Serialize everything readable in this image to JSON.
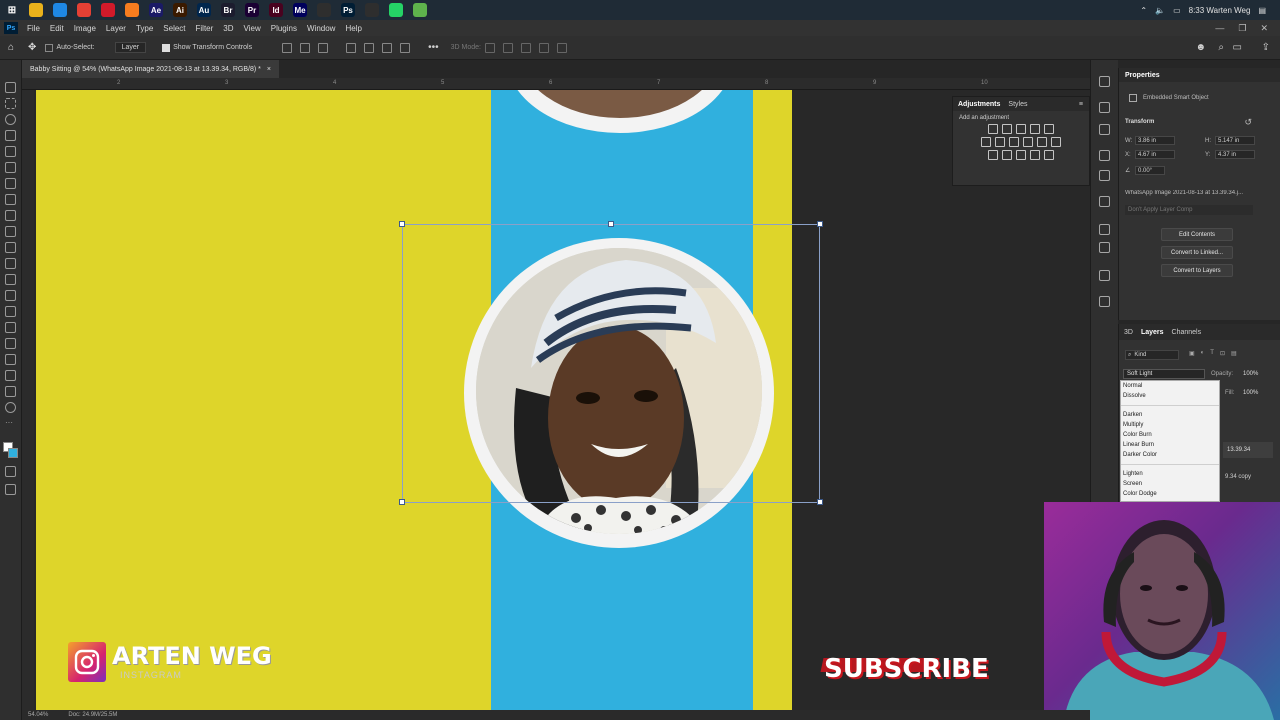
{
  "taskbar": {
    "time_user": "8:33 Warten Weg",
    "apps": [
      {
        "name": "file-explorer-icon",
        "color": "#e8b21c",
        "label": ""
      },
      {
        "name": "edge-icon",
        "color": "#1e88e5",
        "label": ""
      },
      {
        "name": "chrome-icon",
        "color": "#e44034",
        "label": ""
      },
      {
        "name": "opera-icon",
        "color": "#d11a2a",
        "label": ""
      },
      {
        "name": "firefox-icon",
        "color": "#f57c1f",
        "label": ""
      },
      {
        "name": "after-effects-icon",
        "color": "#1a1a66",
        "label": "Ae"
      },
      {
        "name": "illustrator-icon",
        "color": "#3a1a00",
        "label": "Ai"
      },
      {
        "name": "audition-icon",
        "color": "#00264d",
        "label": "Au"
      },
      {
        "name": "bridge-icon",
        "color": "#1c1c2e",
        "label": "Br"
      },
      {
        "name": "premiere-icon",
        "color": "#1a0033",
        "label": "Pr"
      },
      {
        "name": "indesign-icon",
        "color": "#49021f",
        "label": "Id"
      },
      {
        "name": "media-encoder-icon",
        "color": "#00005b",
        "label": "Me"
      },
      {
        "name": "obs-icon",
        "color": "#2e2e2e",
        "label": ""
      },
      {
        "name": "photoshop-icon",
        "color": "#001d34",
        "label": "Ps"
      },
      {
        "name": "settings-app-icon",
        "color": "#2e2e2e",
        "label": ""
      },
      {
        "name": "whatsapp-icon",
        "color": "#25d366",
        "label": ""
      },
      {
        "name": "store-icon",
        "color": "#5fb34c",
        "label": ""
      }
    ]
  },
  "menubar": {
    "items": [
      "File",
      "Edit",
      "Image",
      "Layer",
      "Type",
      "Select",
      "Filter",
      "3D",
      "View",
      "Plugins",
      "Window",
      "Help"
    ]
  },
  "options": {
    "auto_select": "Auto-Select:",
    "layer_select": "Layer",
    "transform_controls": "Show Transform Controls",
    "mode_3d": "3D Mode:"
  },
  "document": {
    "tab_title": "Babby Sitting @ 54% (WhatsApp Image 2021-08-13 at 13.39.34, RGB/8) *",
    "close": "×",
    "ruler_ticks": [
      "2",
      "3",
      "4",
      "5",
      "6",
      "7",
      "8",
      "9",
      "10"
    ],
    "colors": {
      "yellow": "#ded52a",
      "blue": "#30b0de"
    }
  },
  "overlay": {
    "instagram_name": "ARTEN WEG",
    "instagram_sub": "INSTAGRAM",
    "subscribe": "SUBSCRIBE"
  },
  "adjustments": {
    "tab_active": "Adjustments",
    "tab_other": "Styles",
    "add_label": "Add an adjustment"
  },
  "properties": {
    "title": "Properties",
    "object_type": "Embedded Smart Object",
    "transform": "Transform",
    "w_label": "W:",
    "w_value": "3.86 in",
    "h_label": "H:",
    "h_value": "5.147 in",
    "x_label": "X:",
    "x_value": "4.67 in",
    "y_label": "Y:",
    "y_value": "4.37 in",
    "angle_value": "0.00°",
    "linked_file": "WhatsApp Image 2021-08-13 at 13.39.34.j...",
    "layer_comp": "Don't Apply Layer Comp",
    "btn_edit": "Edit Contents",
    "btn_linked": "Convert to Linked...",
    "btn_layers": "Convert to Layers"
  },
  "layers": {
    "tab_3d": "3D",
    "tab_layers": "Layers",
    "tab_channels": "Channels",
    "kind": "Kind",
    "blend_mode": "Soft Light",
    "opacity_label": "Opacity:",
    "opacity_value": "100%",
    "fill_label": "Fill:",
    "fill_value": "100%",
    "layer_1": "13.39.34",
    "layer_2": "9.34 copy"
  },
  "blend_dropdown": {
    "group1": [
      "Normal",
      "Dissolve"
    ],
    "group2": [
      "Darken",
      "Multiply",
      "Color Burn",
      "Linear Burn",
      "Darker Color"
    ],
    "group3": [
      "Lighten",
      "Screen",
      "Color Dodge"
    ]
  },
  "status": {
    "zoom": "54.04%",
    "doc": "Doc: 24.9M/25.5M"
  }
}
